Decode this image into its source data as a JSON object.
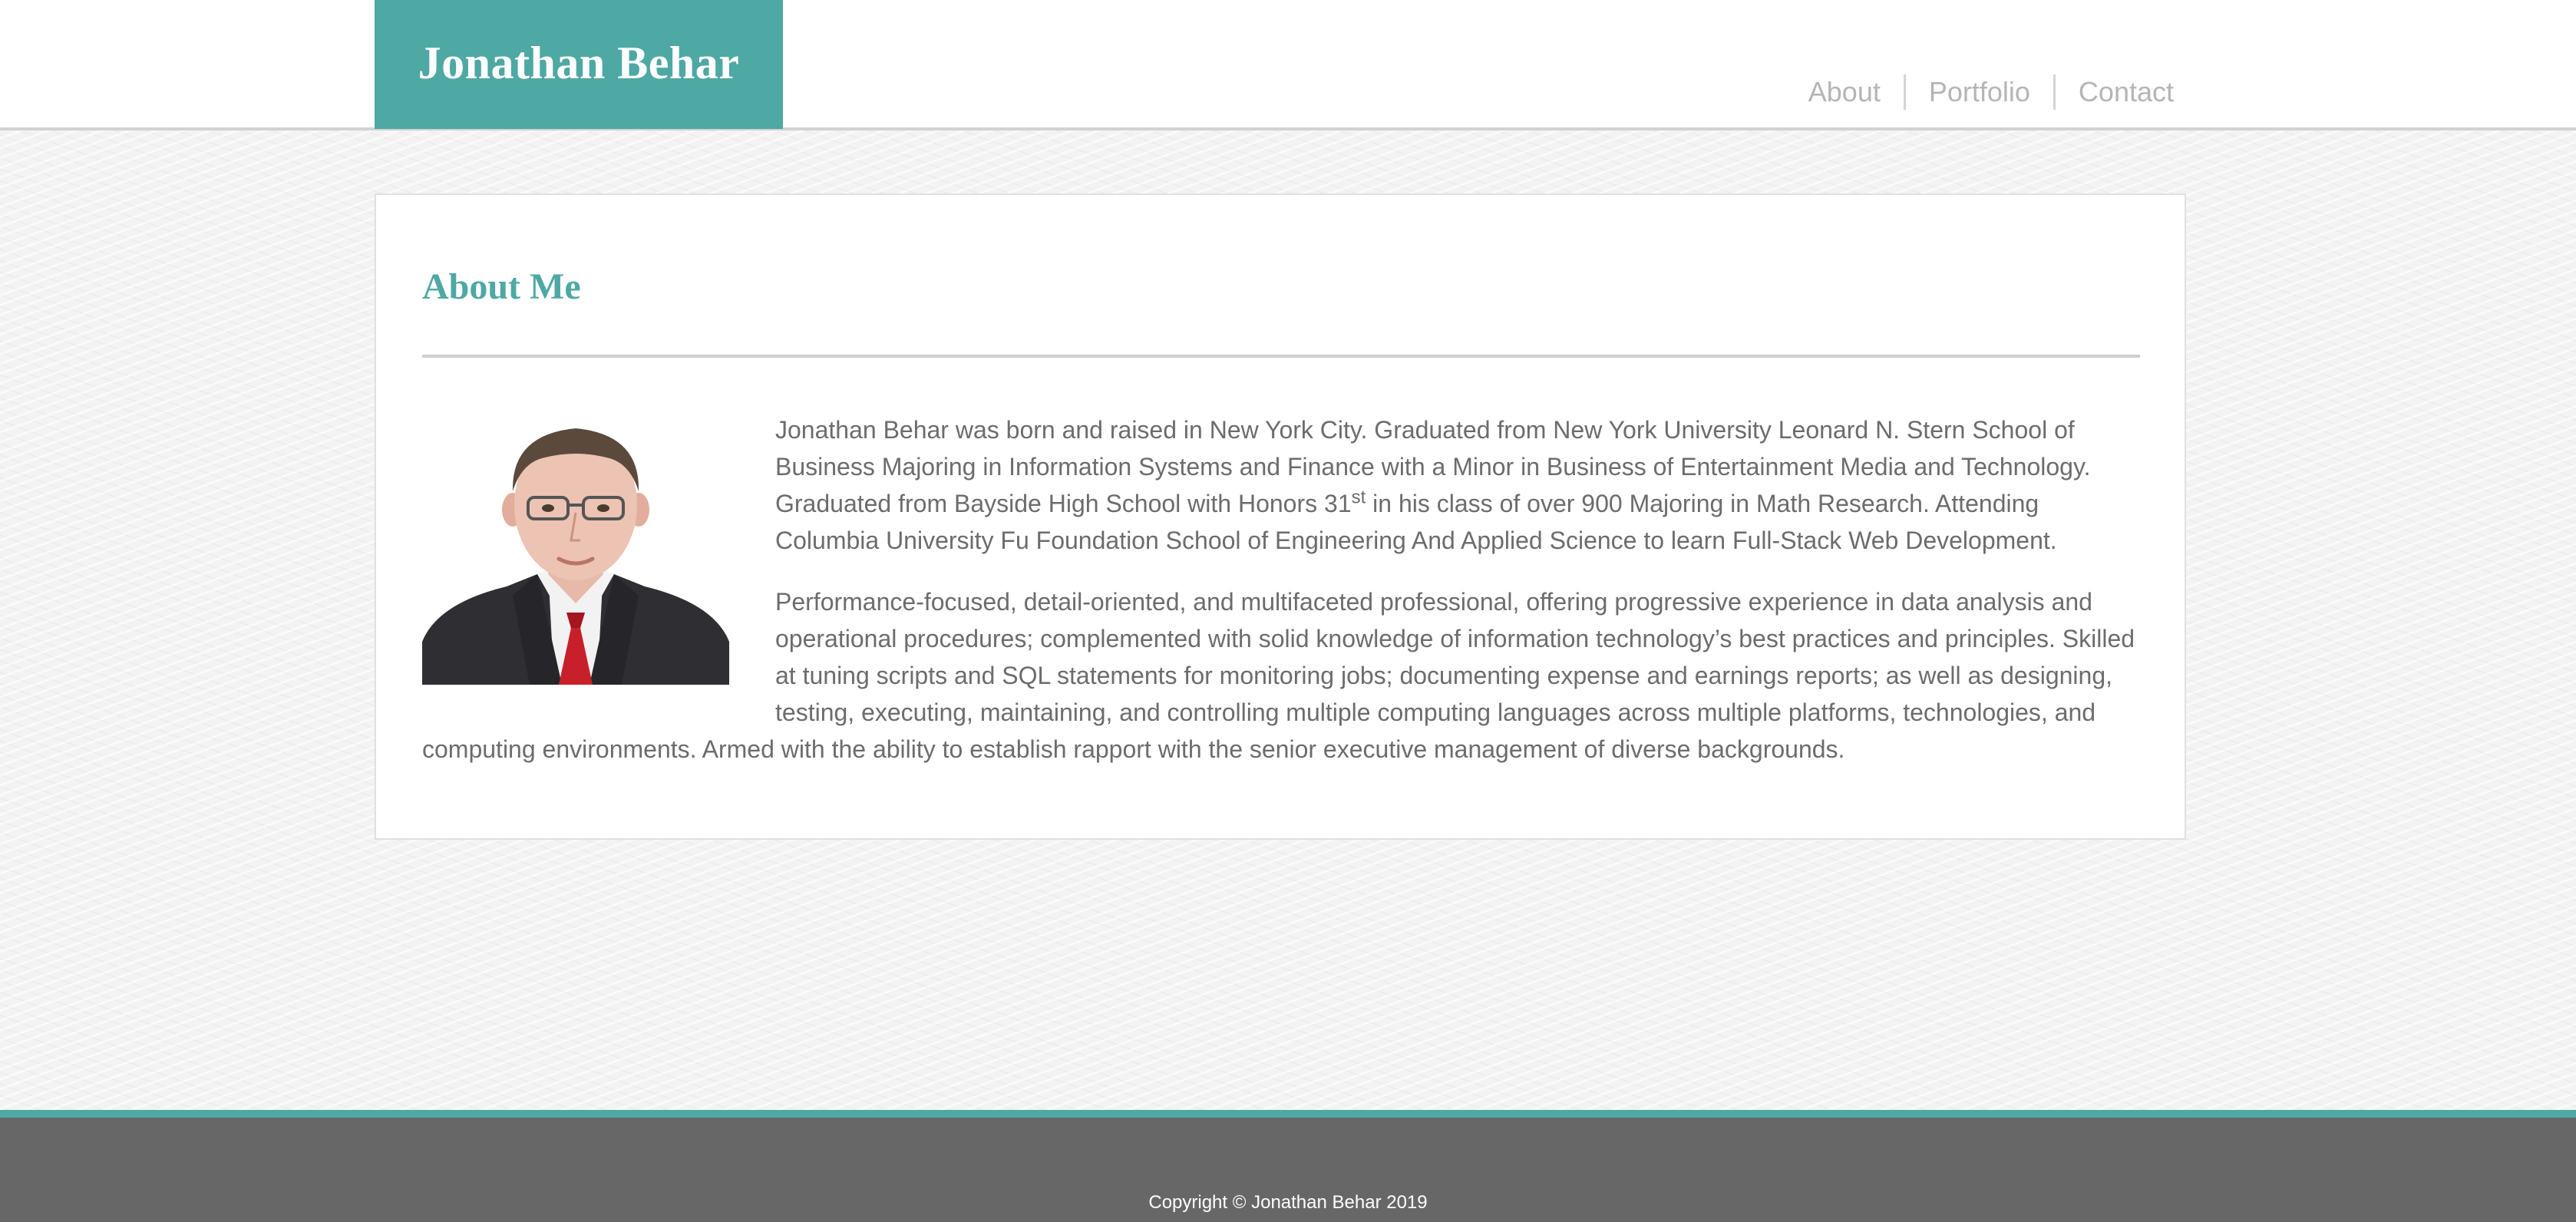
{
  "header": {
    "brand": "Jonathan Behar",
    "nav": [
      {
        "label": "About"
      },
      {
        "label": "Portfolio"
      },
      {
        "label": "Contact"
      }
    ]
  },
  "about": {
    "title": "About Me",
    "portrait_alt": "Portrait of Jonathan Behar",
    "paragraph1_part1": "Jonathan Behar was born and raised in New York City. Graduated from New York University Leonard N. Stern School of Business Majoring in Information Systems and Finance with a Minor in Business of Entertainment Media and Technology. Graduated from Bayside High School with Honors 31",
    "paragraph1_sup": "st",
    "paragraph1_part2": " in his class of over 900 Majoring in Math Research. Attending Columbia University Fu Foundation School of Engineering And Applied Science to learn Full-Stack Web Development.",
    "paragraph2": "Performance-focused, detail-oriented, and multifaceted professional, offering progressive experience in data analysis and operational procedures; complemented with solid knowledge of information technology’s best practices and principles. Skilled at tuning scripts and SQL statements for monitoring jobs; documenting expense and earnings reports; as well as designing, testing, executing, maintaining, and controlling multiple computing languages across multiple platforms, technologies, and computing environments. Armed with the ability to establish rapport with the senior executive management of diverse backgrounds."
  },
  "footer": {
    "copyright": "Copyright © Jonathan Behar 2019"
  },
  "colors": {
    "accent": "#4ea8a4",
    "footer_bg": "#676767",
    "body_text": "#6c6c6c",
    "nav_text": "#b5b5b5"
  }
}
